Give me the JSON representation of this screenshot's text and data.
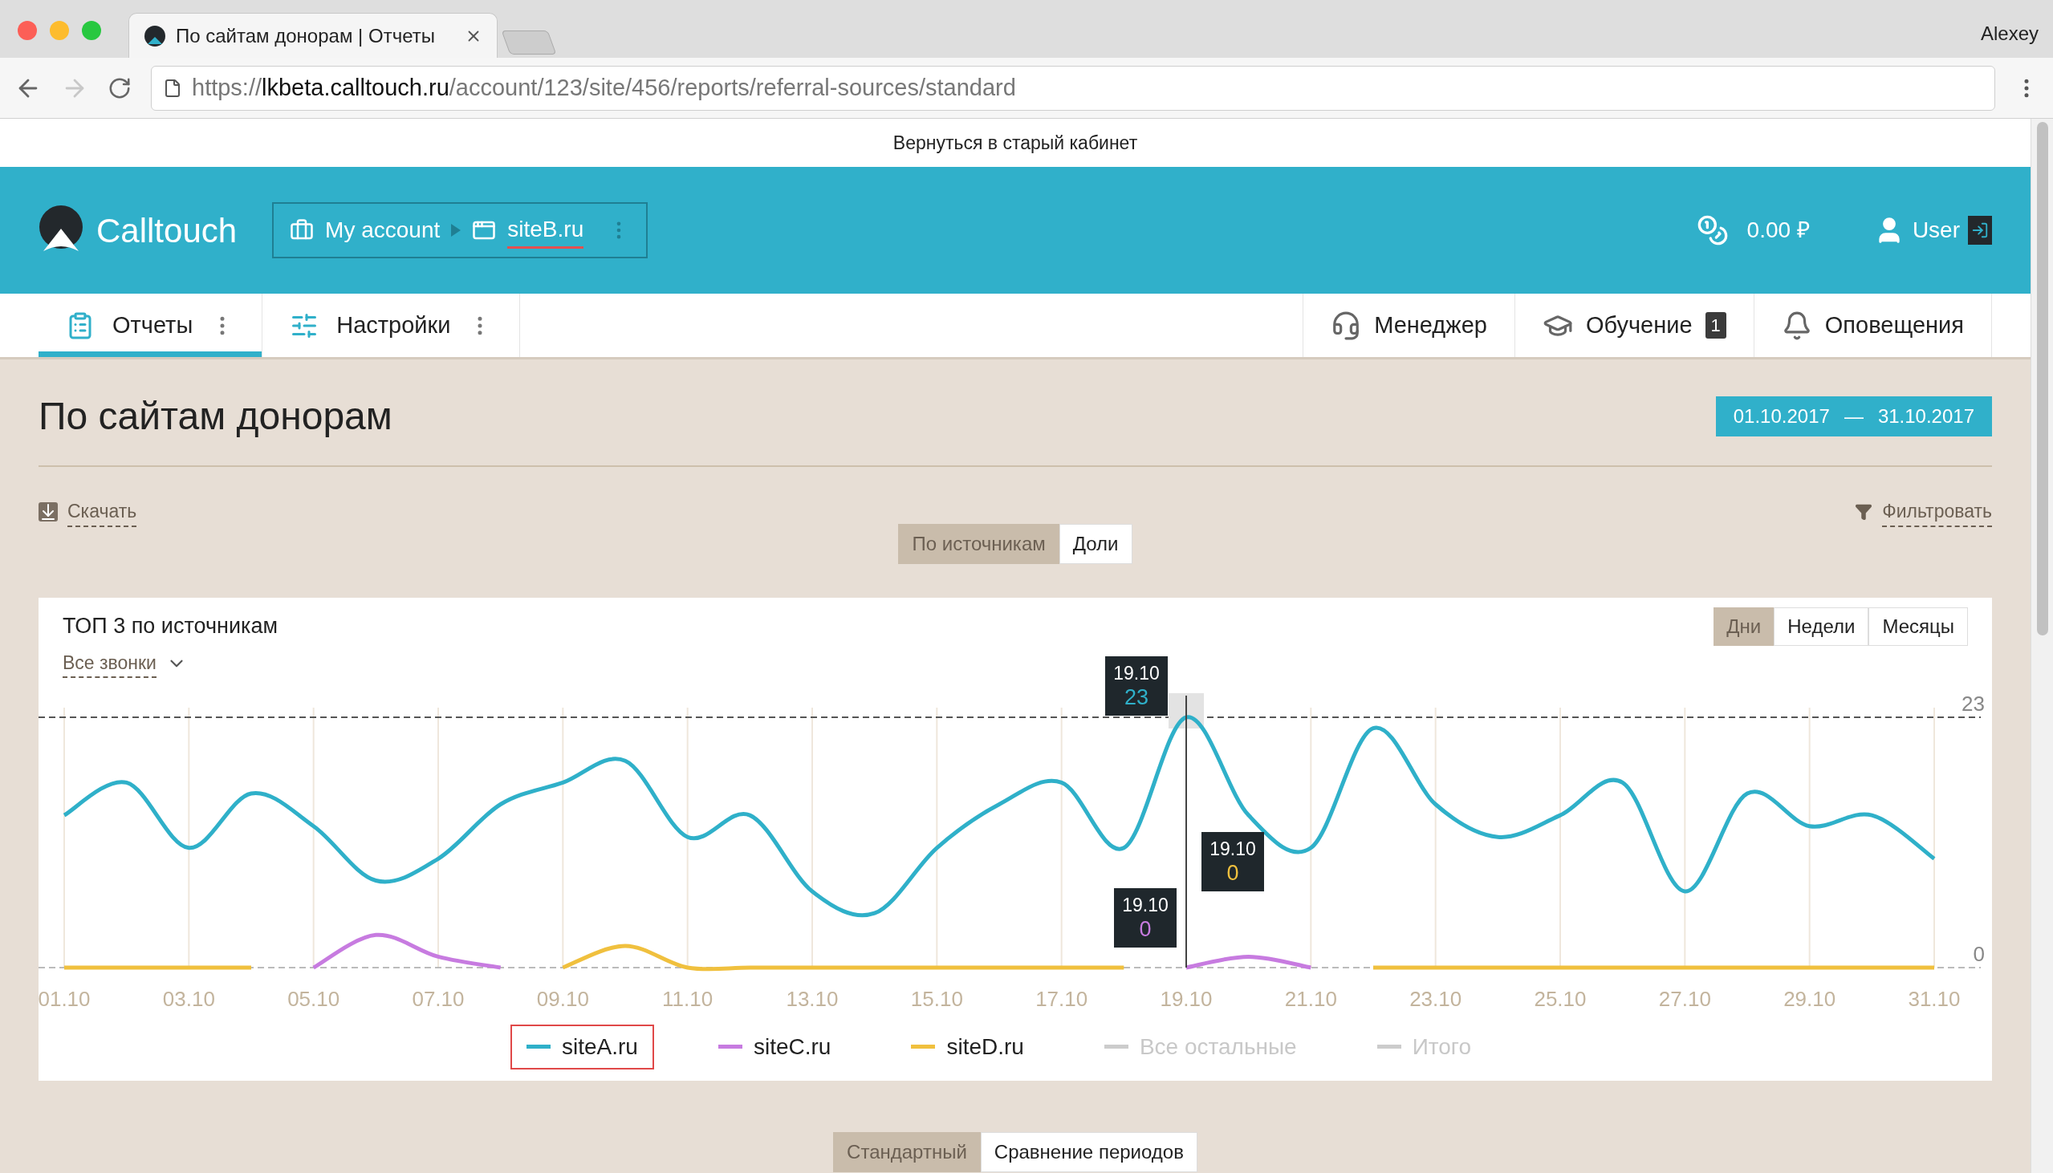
{
  "browser": {
    "tab_title": "По сайтам донорам | Отчеты",
    "url": {
      "scheme": "https://",
      "host": "lkbeta.calltouch.ru",
      "path": "/account/123/site/456/reports/referral-sources/standard"
    },
    "profile": "Alexey"
  },
  "notice": "Вернуться в старый кабинет",
  "header": {
    "brand": "Calltouch",
    "breadcrumb": [
      "My account",
      "siteB.ru"
    ],
    "balance": "0.00 ₽",
    "user": "User"
  },
  "nav": {
    "left": [
      {
        "label": "Отчеты",
        "selected": true
      },
      {
        "label": "Настройки",
        "selected": false
      }
    ],
    "right": [
      {
        "label": "Менеджер"
      },
      {
        "label": "Обучение",
        "badge": "1"
      },
      {
        "label": "Оповещения"
      }
    ]
  },
  "page": {
    "title": "По сайтам донорам",
    "date_from": "01.10.2017",
    "date_sep": "—",
    "date_to": "31.10.2017",
    "download": "Скачать",
    "filter": "Фильтровать",
    "view_toggle": [
      {
        "label": "По источникам",
        "selected": true
      },
      {
        "label": "Доли",
        "selected": false
      }
    ],
    "mode_toggle": [
      {
        "label": "Стандартный",
        "selected": true
      },
      {
        "label": "Сравнение периодов",
        "selected": false
      }
    ]
  },
  "chart_card": {
    "title": "ТОП 3 по источникам",
    "calls_filter": "Все звонки",
    "period_tabs": [
      {
        "label": "Дни",
        "selected": true
      },
      {
        "label": "Недели",
        "selected": false
      },
      {
        "label": "Месяцы",
        "selected": false
      }
    ],
    "tooltips": [
      {
        "date": "19.10",
        "value": "23",
        "color": "#2fb0c9"
      },
      {
        "date": "19.10",
        "value": "0",
        "color": "#f0c03e"
      },
      {
        "date": "19.10",
        "value": "0",
        "color": "#c77be0"
      }
    ],
    "chart_data": {
      "type": "line",
      "grid": true,
      "categories": [
        "01.10",
        null,
        "03.10",
        null,
        "05.10",
        null,
        "07.10",
        null,
        "09.10",
        null,
        "11.10",
        null,
        "13.10",
        null,
        "15.10",
        null,
        "17.10",
        null,
        "19.10",
        null,
        "21.10",
        null,
        "23.10",
        null,
        "25.10",
        null,
        "27.10",
        null,
        "29.10",
        null,
        "31.10"
      ],
      "ylim": [
        0,
        23
      ],
      "yticks": [
        0,
        23
      ],
      "series": [
        {
          "name": "siteA.ru",
          "color": "#2fb0c9",
          "values": [
            14,
            17,
            11,
            16,
            13,
            8,
            10,
            15,
            17,
            19,
            12,
            14,
            7,
            5,
            11,
            15,
            17,
            11,
            23,
            14,
            11,
            22,
            15,
            12,
            14,
            17,
            7,
            16,
            13,
            14,
            10
          ]
        },
        {
          "name": "siteC.ru",
          "color": "#c77be0",
          "values": [
            null,
            null,
            null,
            null,
            0,
            3,
            1,
            0,
            null,
            null,
            null,
            null,
            null,
            null,
            null,
            null,
            null,
            null,
            0,
            1,
            0,
            null,
            null,
            null,
            null,
            null,
            null,
            null,
            null,
            null,
            null
          ]
        },
        {
          "name": "siteD.ru",
          "color": "#f0c03e",
          "values": [
            0,
            0,
            0,
            0,
            null,
            null,
            null,
            null,
            0,
            2,
            0,
            0,
            0,
            0,
            0,
            0,
            0,
            0,
            null,
            null,
            null,
            0,
            0,
            0,
            0,
            0,
            0,
            0,
            0,
            0,
            0
          ]
        }
      ]
    },
    "legend": [
      {
        "selected": true
      },
      {
        "selected": false
      },
      {
        "selected": false
      }
    ],
    "legend_extra": [
      {
        "label": "Все остальные",
        "enabled": false
      },
      {
        "label": "Итого",
        "enabled": false
      }
    ]
  }
}
